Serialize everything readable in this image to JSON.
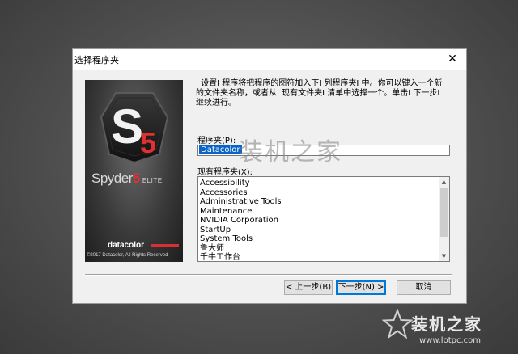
{
  "dialog": {
    "title": "选择程序夹",
    "close_glyph": "✕"
  },
  "product": {
    "logo_letter": "S",
    "logo_number": "5",
    "name_prefix": "Spyder",
    "name_number": "5",
    "edition": "ELITE",
    "brand": "datacolor",
    "copyright": "©2017 Datacolor, All Rights Reserved"
  },
  "instructions": "Ⅰ 设置Ⅰ 程序将把程序的图符加入下Ⅰ 列程序夹Ⅰ 中。你可以键入一个新的文件夹名称，或者从Ⅰ 现有文件夹Ⅰ 清单中选择一个。单击Ⅰ 下一步Ⅰ 继续进行。",
  "folder_field": {
    "label": "程序夹(P):",
    "value": "Datacolor"
  },
  "existing_folders": {
    "label": "现有程序夹(X):",
    "items": [
      "Accessibility",
      "Accessories",
      "Administrative Tools",
      "Maintenance",
      "NVIDIA Corporation",
      "StartUp",
      "System Tools",
      "鲁大师",
      "千牛工作台"
    ]
  },
  "buttons": {
    "back": "< 上一步(B)",
    "next": "下一步(N) >",
    "cancel": "取消"
  },
  "watermark": {
    "center": "装机之家",
    "corner_title": "装机之家",
    "corner_url": "www.lotpc.com"
  },
  "colors": {
    "selection": "#0a64c8",
    "brand_red": "#d83030"
  }
}
